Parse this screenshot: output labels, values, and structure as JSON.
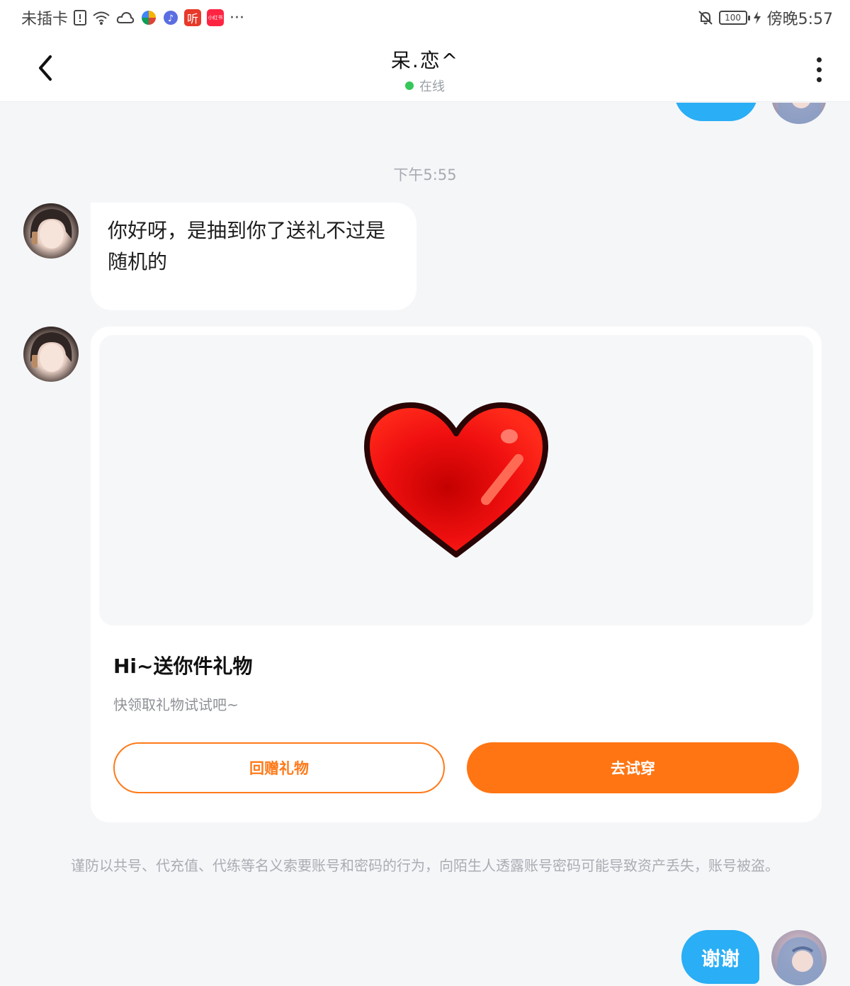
{
  "status_bar": {
    "carrier": "未插卡",
    "apps": [
      {
        "name": "ting-app-icon",
        "label": "听",
        "color": "#e8392a"
      },
      {
        "name": "xiaohongshu-app-icon",
        "label": "小红书",
        "color": "#ff2442"
      }
    ],
    "more": "···",
    "battery": "100",
    "time": "傍晚5:57"
  },
  "header": {
    "back_icon": "chevron-left-icon",
    "title": "呆.恋^",
    "status": "在线",
    "status_color": "#35c759",
    "more_icon": "more-vertical-icon"
  },
  "chat": {
    "timestamp": "下午5:55",
    "incoming_text": "你好呀，是抽到你了送礼不过是随机的",
    "gift_card": {
      "image_icon": "heart-gift-icon",
      "title": "Hi~送你件礼物",
      "subtitle": "快领取礼物试试吧~",
      "return_button": "回赠礼物",
      "try_button": "去试穿",
      "accent_color": "#ff7513"
    },
    "warning": "谨防以共号、代充值、代练等名义索要账号和密码的行为，向陌生人透露账号密码可能导致资产丢失，账号被盗。",
    "outgoing_text": "谢谢",
    "outgoing_color": "#2aaef5"
  }
}
